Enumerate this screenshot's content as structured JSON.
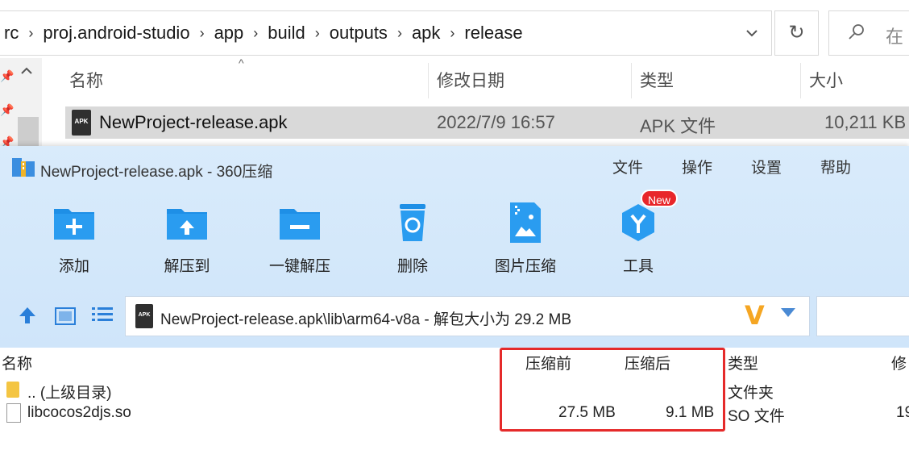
{
  "explorer": {
    "breadcrumbs": [
      "rc",
      "proj.android-studio",
      "app",
      "build",
      "outputs",
      "apk",
      "release"
    ],
    "breadcrumb_separator": "›",
    "search_placeholder": "在",
    "columns": {
      "name": "名称",
      "modified": "修改日期",
      "type": "类型",
      "size": "大小"
    },
    "file": {
      "icon_text": "APK",
      "name": "NewProject-release.apk",
      "modified": "2022/7/9 16:57",
      "type": "APK 文件",
      "size": "10,211 KB"
    },
    "icons": {
      "dropdown": "chevron-down-icon",
      "refresh": "refresh-icon",
      "search": "search-icon",
      "pin": "pin-icon"
    }
  },
  "zip": {
    "title": "NewProject-release.apk - 360压缩",
    "menu": [
      "文件",
      "操作",
      "设置",
      "帮助"
    ],
    "tools": [
      {
        "label": "添加",
        "icon": "add-icon"
      },
      {
        "label": "解压到",
        "icon": "extract-to-icon"
      },
      {
        "label": "一键解压",
        "icon": "one-click-extract-icon"
      },
      {
        "label": "删除",
        "icon": "recycle-bin-icon"
      },
      {
        "label": "图片压缩",
        "icon": "image-compress-icon"
      },
      {
        "label": "工具",
        "icon": "tools-icon"
      }
    ],
    "new_badge": "New",
    "path_icon_text": "APK",
    "path": "NewProject-release.apk\\lib\\arm64-v8a - 解包大小为 29.2 MB",
    "list_columns": {
      "name": "名称",
      "before": "压缩前",
      "after": "压缩后",
      "type": "类型",
      "modified": "修"
    },
    "rows": [
      {
        "name": ".. (上级目录)",
        "before": "",
        "after": "",
        "type": "文件夹",
        "modified": ""
      },
      {
        "name": "libcocos2djs.so",
        "before": "27.5 MB",
        "after": "9.1 MB",
        "type": "SO 文件",
        "modified": "19"
      }
    ],
    "colors": {
      "accent": "#2a7fd9",
      "highlight": "#e52a2a",
      "badge": "#e8262a",
      "toolbar_bg": "#d9ebfb"
    }
  }
}
